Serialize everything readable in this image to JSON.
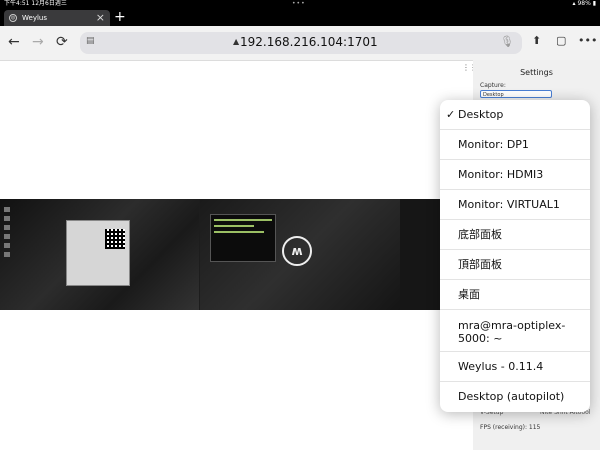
{
  "status_bar": {
    "time": "下午4:51  12月6日週三",
    "battery": "98%"
  },
  "tab": {
    "title": "Weylus"
  },
  "toolbar": {
    "url": "192.168.216.104:1701"
  },
  "settings": {
    "title": "Settings",
    "capture_label": "Capture:",
    "capture_value": "Desktop",
    "vsetup_label": "V-Setup",
    "vsetup_value": "Nite Shift Aitoool",
    "fps_label": "FPS (receiving): 115"
  },
  "dropdown": {
    "selected_index": 0,
    "options": [
      "Desktop",
      "Monitor: DP1",
      "Monitor: HDMI3",
      "Monitor: VIRTUAL1",
      "底部面板",
      "頂部面板",
      "桌面",
      "mra@mra-optiplex-5000: ~",
      "Weylus - 0.11.4",
      "Desktop (autopilot)"
    ]
  },
  "icons": {
    "back": "←",
    "forward": "→",
    "reload": "⟳",
    "reader": "reader-icon",
    "share": "⬆",
    "tabs": "tabs-icon",
    "more": "•••",
    "mic": "mic-icon"
  }
}
